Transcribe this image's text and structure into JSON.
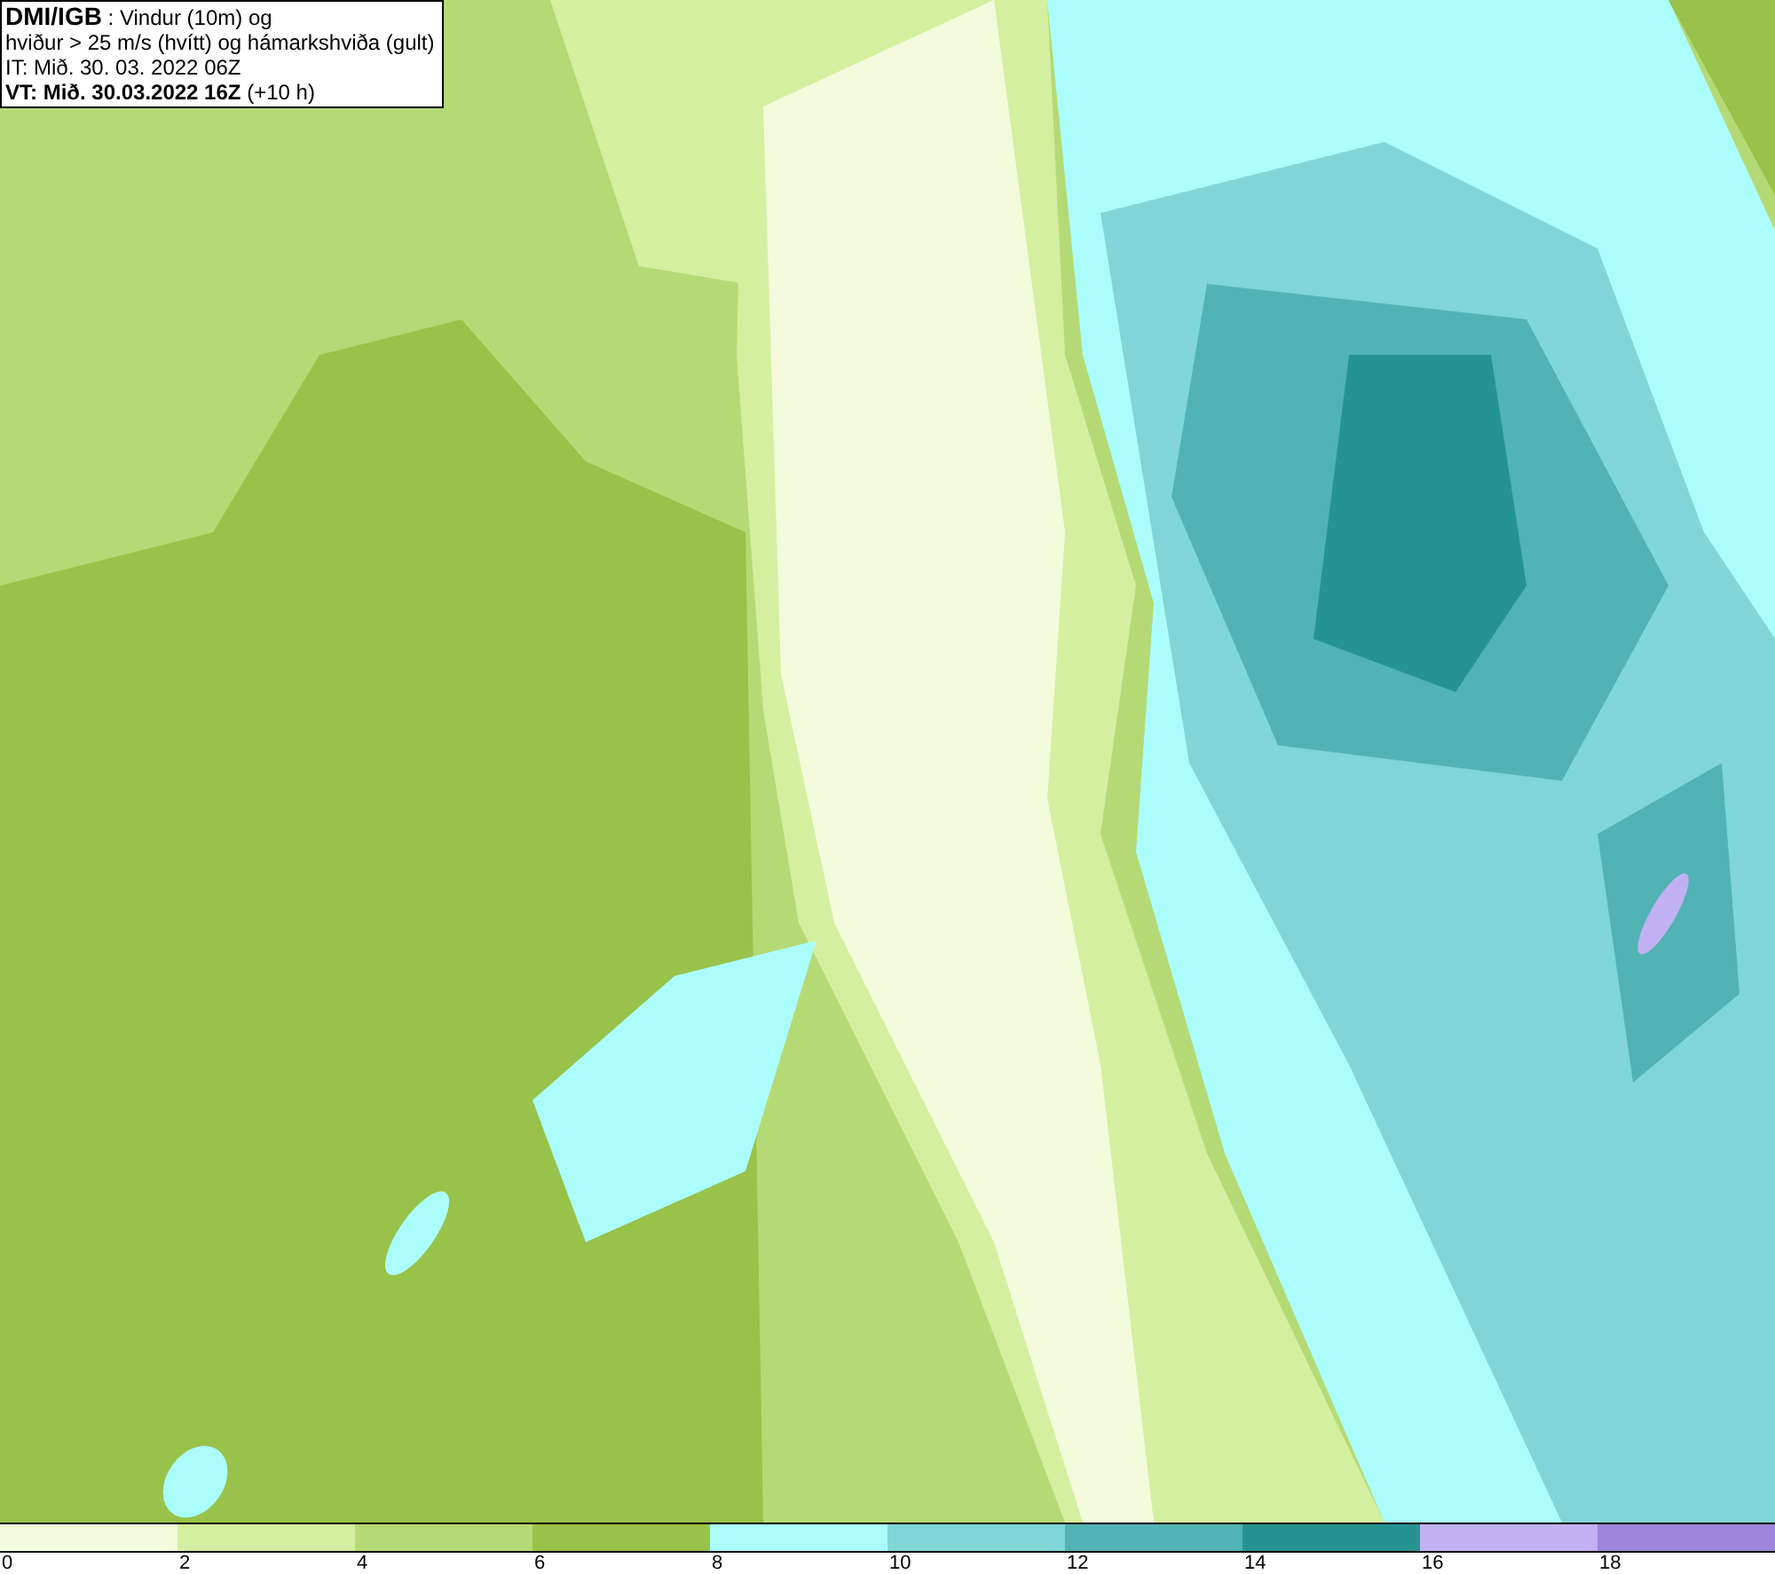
{
  "header": {
    "title": "DMI/IGB",
    "title_rest": ": Vindur (10m) og",
    "line_2": "hviður > 25 m/s (hvítt) og hámarkshviða (gult)",
    "line_3": "IT: Mið. 30. 03. 2022 06Z",
    "valid_time": "VT: Mið. 30.03.2022 16Z",
    "lead": "(+10 h)"
  },
  "legend": {
    "segments": [
      {
        "color": "#f4fbdc",
        "label": "0"
      },
      {
        "color": "#d5efa0",
        "label": "2"
      },
      {
        "color": "#b5da75",
        "label": "4"
      },
      {
        "color": "#98c249",
        "label": "6"
      },
      {
        "color": "#abfdfd",
        "label": "8"
      },
      {
        "color": "#80d6d6",
        "label": "10"
      },
      {
        "color": "#51b3b3",
        "label": "12"
      },
      {
        "color": "#269393",
        "label": "14"
      },
      {
        "color": "#c1b1f3",
        "label": "16"
      },
      {
        "color": "#9d85dc",
        "label": "18"
      }
    ]
  }
}
